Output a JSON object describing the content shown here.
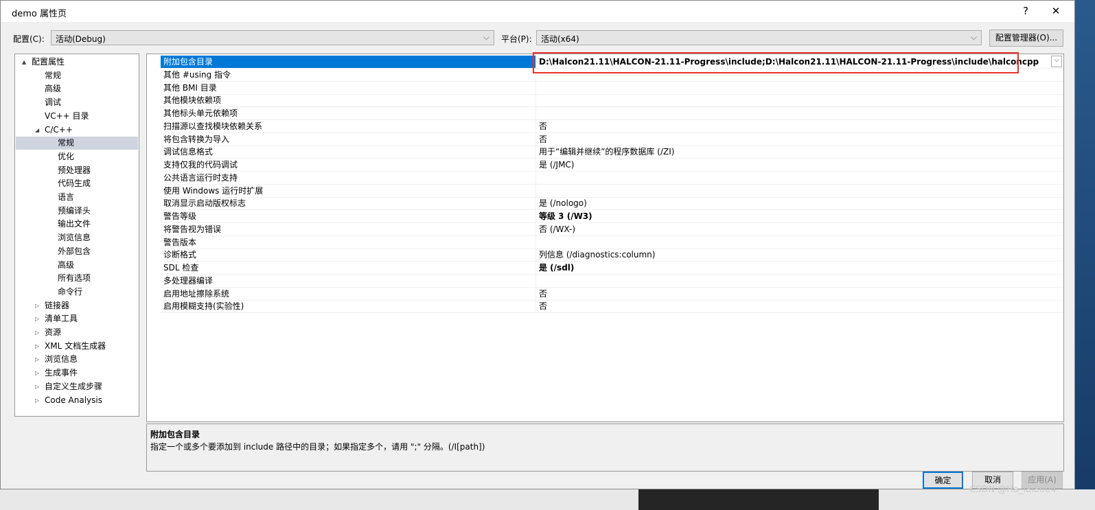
{
  "window": {
    "title": "demo 属性页",
    "help": "?",
    "close": "✕"
  },
  "config": {
    "label": "配置(C):",
    "value": "活动(Debug)",
    "platform_label": "平台(P):",
    "platform_value": "活动(x64)",
    "manager_button": "配置管理器(O)..."
  },
  "tree": [
    {
      "label": "配置属性",
      "level": 0,
      "arrow": "▲"
    },
    {
      "label": "常规",
      "level": 1
    },
    {
      "label": "高级",
      "level": 1
    },
    {
      "label": "调试",
      "level": 1
    },
    {
      "label": "VC++ 目录",
      "level": 1
    },
    {
      "label": "C/C++",
      "level": 1,
      "arrow": "◢"
    },
    {
      "label": "常规",
      "level": 2,
      "selected": true
    },
    {
      "label": "优化",
      "level": 2
    },
    {
      "label": "预处理器",
      "level": 2
    },
    {
      "label": "代码生成",
      "level": 2
    },
    {
      "label": "语言",
      "level": 2
    },
    {
      "label": "预编译头",
      "level": 2
    },
    {
      "label": "输出文件",
      "level": 2
    },
    {
      "label": "浏览信息",
      "level": 2
    },
    {
      "label": "外部包含",
      "level": 2
    },
    {
      "label": "高级",
      "level": 2
    },
    {
      "label": "所有选项",
      "level": 2
    },
    {
      "label": "命令行",
      "level": 2
    },
    {
      "label": "链接器",
      "level": 1,
      "arrow": "▷"
    },
    {
      "label": "清单工具",
      "level": 1,
      "arrow": "▷"
    },
    {
      "label": "资源",
      "level": 1,
      "arrow": "▷"
    },
    {
      "label": "XML 文档生成器",
      "level": 1,
      "arrow": "▷"
    },
    {
      "label": "浏览信息",
      "level": 1,
      "arrow": "▷"
    },
    {
      "label": "生成事件",
      "level": 1,
      "arrow": "▷"
    },
    {
      "label": "自定义生成步骤",
      "level": 1,
      "arrow": "▷"
    },
    {
      "label": "Code Analysis",
      "level": 1,
      "arrow": "▷"
    }
  ],
  "properties": [
    {
      "name": "附加包含目录",
      "value": "D:\\Halcon21.11\\HALCON-21.11-Progress\\include;D:\\Halcon21.11\\HALCON-21.11-Progress\\include\\halconcpp",
      "bold": true,
      "selected": true
    },
    {
      "name": "其他 #using 指令",
      "value": ""
    },
    {
      "name": "其他 BMI 目录",
      "value": ""
    },
    {
      "name": "其他模块依赖项",
      "value": ""
    },
    {
      "name": "其他标头单元依赖项",
      "value": ""
    },
    {
      "name": "扫描源以查找模块依赖关系",
      "value": "否"
    },
    {
      "name": "将包含转换为导入",
      "value": "否"
    },
    {
      "name": "调试信息格式",
      "value": "用于“编辑并继续”的程序数据库 (/ZI)"
    },
    {
      "name": "支持仅我的代码调试",
      "value": "是 (/JMC)"
    },
    {
      "name": "公共语言运行时支持",
      "value": ""
    },
    {
      "name": "使用 Windows 运行时扩展",
      "value": ""
    },
    {
      "name": "取消显示启动版权标志",
      "value": "是 (/nologo)"
    },
    {
      "name": "警告等级",
      "value": "等级 3 (/W3)",
      "bold": true
    },
    {
      "name": "将警告视为错误",
      "value": "否 (/WX-)"
    },
    {
      "name": "警告版本",
      "value": ""
    },
    {
      "name": "诊断格式",
      "value": "列信息 (/diagnostics:column)"
    },
    {
      "name": "SDL 检查",
      "value": "是 (/sdl)",
      "bold": true
    },
    {
      "name": "多处理器编译",
      "value": ""
    },
    {
      "name": "启用地址擦除系统",
      "value": "否"
    },
    {
      "name": "启用模糊支持(实验性)",
      "value": "否"
    }
  ],
  "description": {
    "title": "附加包含目录",
    "text": "指定一个或多个要添加到 include 路径中的目录；如果指定多个，请用 \";\" 分隔。(/I[path])"
  },
  "buttons": {
    "ok": "确定",
    "cancel": "取消",
    "apply": "应用(A)"
  },
  "watermark": "CSDN @Ha_lala604",
  "colors": {
    "selection": "#0078d7",
    "highlight_box": "#e8302a"
  }
}
